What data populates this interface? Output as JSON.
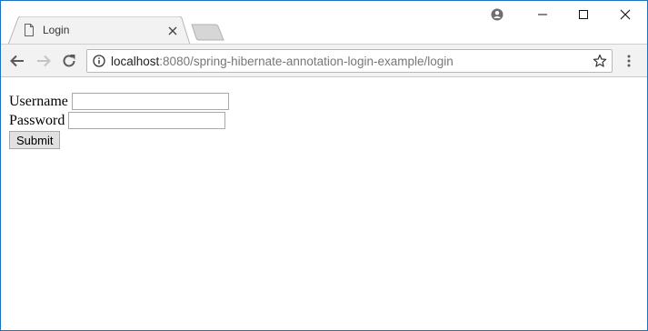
{
  "tab": {
    "title": "Login",
    "page_icon": "page-icon",
    "close_icon": "close-icon"
  },
  "window_controls": {
    "profile_icon": "profile-icon",
    "minimize_icon": "minimize-icon",
    "maximize_icon": "maximize-icon",
    "close_icon": "close-icon"
  },
  "toolbar": {
    "back_icon": "arrow-left-icon",
    "forward_icon": "arrow-right-icon",
    "reload_icon": "reload-icon",
    "info_icon": "info-icon",
    "star_icon": "star-icon",
    "menu_icon": "kebab-menu-icon",
    "url_host": "localhost",
    "url_rest": ":8080/spring-hibernate-annotation-login-example/login"
  },
  "form": {
    "username_label": "Username",
    "username_value": "",
    "password_label": "Password",
    "password_value": "",
    "submit_label": "Submit"
  },
  "colors": {
    "window_border": "#1e73be",
    "toolbar_bg": "#f2f2f2",
    "url_host": "#222222",
    "url_rest": "#777777"
  }
}
